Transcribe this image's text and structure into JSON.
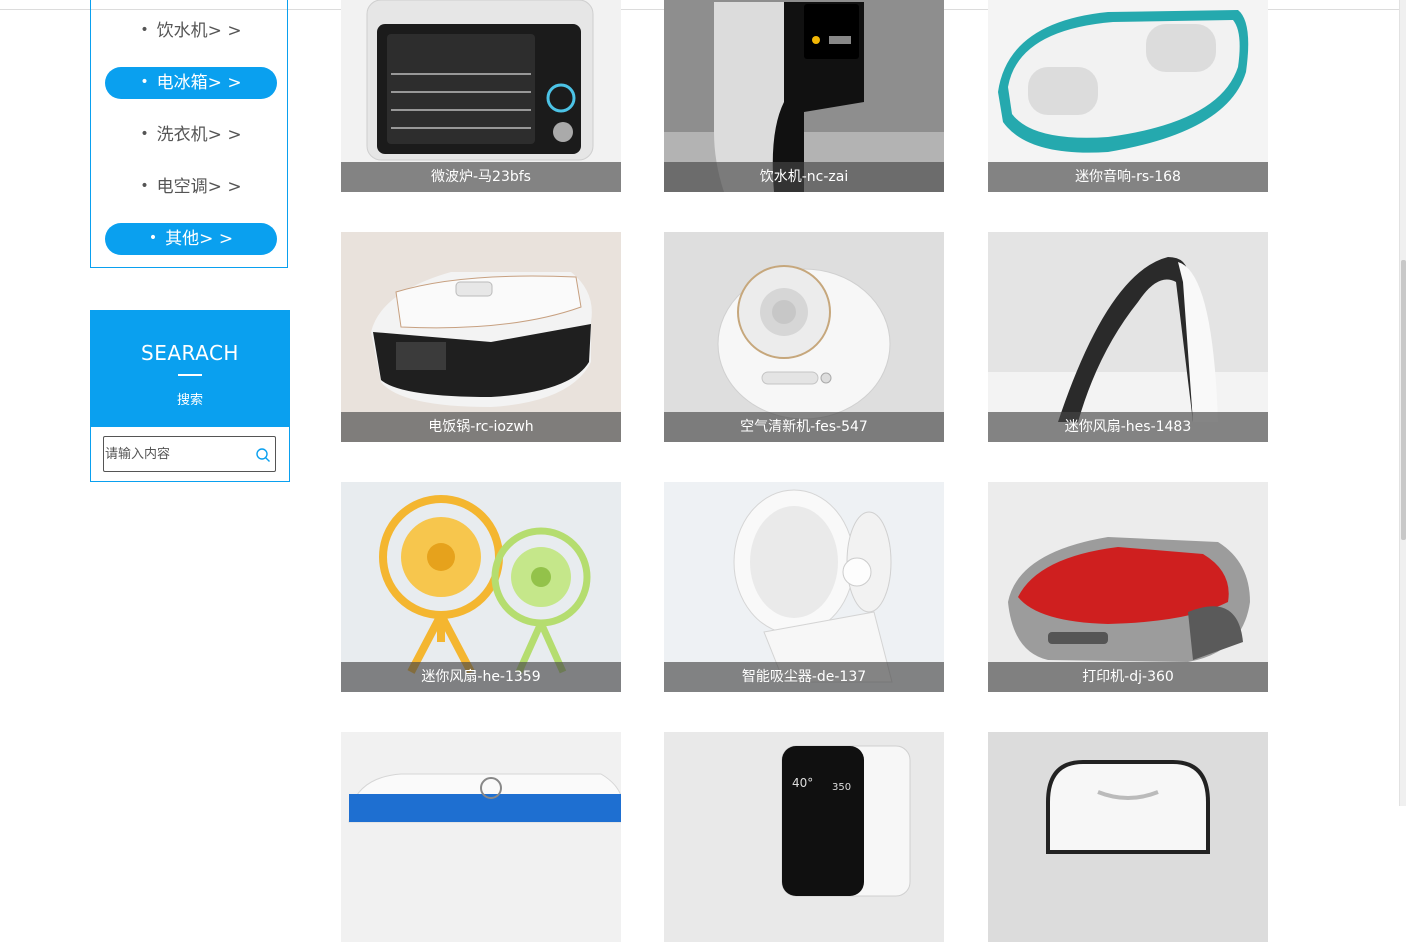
{
  "sidebar": {
    "categories": [
      {
        "label": "饮水机> >",
        "active": false
      },
      {
        "label": "电冰箱> >",
        "active": true
      },
      {
        "label": "洗衣机> >",
        "active": false
      },
      {
        "label": "电空调> >",
        "active": false
      },
      {
        "label": "其他> >",
        "active": true
      }
    ],
    "bullet": "•"
  },
  "search": {
    "title": "SEARACH",
    "subtitle": "搜索",
    "placeholder": "请输入内容"
  },
  "products": [
    {
      "caption": "微波炉-马23bfs"
    },
    {
      "caption": "饮水机-nc-zai"
    },
    {
      "caption": "迷你音响-rs-168"
    },
    {
      "caption": "电饭锅-rc-iozwh"
    },
    {
      "caption": "空气清新机-fes-547"
    },
    {
      "caption": "迷你风扇-hes-1483"
    },
    {
      "caption": "迷你风扇-he-1359"
    },
    {
      "caption": "智能吸尘器-de-137"
    },
    {
      "caption": "打印机-dj-360"
    },
    {
      "caption": ""
    },
    {
      "caption": ""
    },
    {
      "caption": ""
    }
  ],
  "colors": {
    "accent": "#0aa0ef"
  }
}
